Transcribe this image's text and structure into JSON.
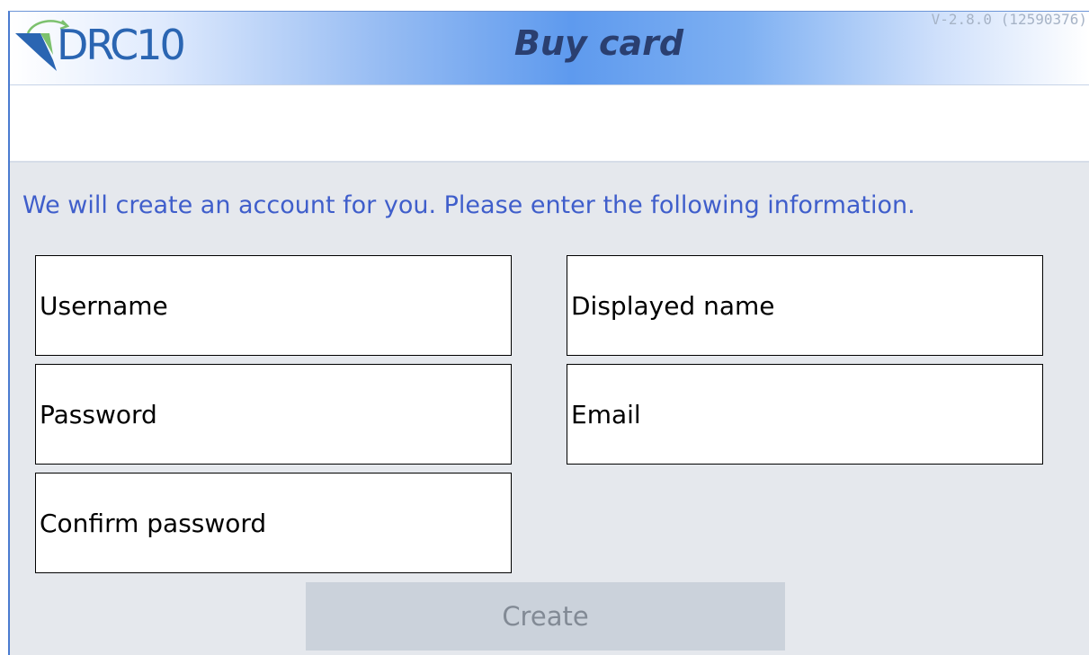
{
  "header": {
    "logo_text": "DRC10",
    "title": "Buy card",
    "version": "V-2.8.0 (12590376)"
  },
  "form": {
    "intro": "We will create an account for you. Please enter the following information.",
    "fields": {
      "username": {
        "placeholder": "Username",
        "value": ""
      },
      "password": {
        "placeholder": "Password",
        "value": ""
      },
      "confirm_password": {
        "placeholder": "Confirm password",
        "value": ""
      },
      "displayed_name": {
        "placeholder": "Displayed name",
        "value": ""
      },
      "email": {
        "placeholder": "Email",
        "value": ""
      }
    },
    "create_label": "Create",
    "create_enabled": false
  },
  "colors": {
    "header_accent": "#5e9aee",
    "title_text": "#2a3f70",
    "intro_text": "#3f5ecb",
    "content_bg": "#e5e8ed",
    "button_disabled_bg": "#cbd2db",
    "button_disabled_text": "#828a95",
    "logo_blue": "#2a65b2",
    "logo_green": "#7cc16d"
  },
  "icons": {
    "logo": "drc10-leaf-logo-icon"
  }
}
